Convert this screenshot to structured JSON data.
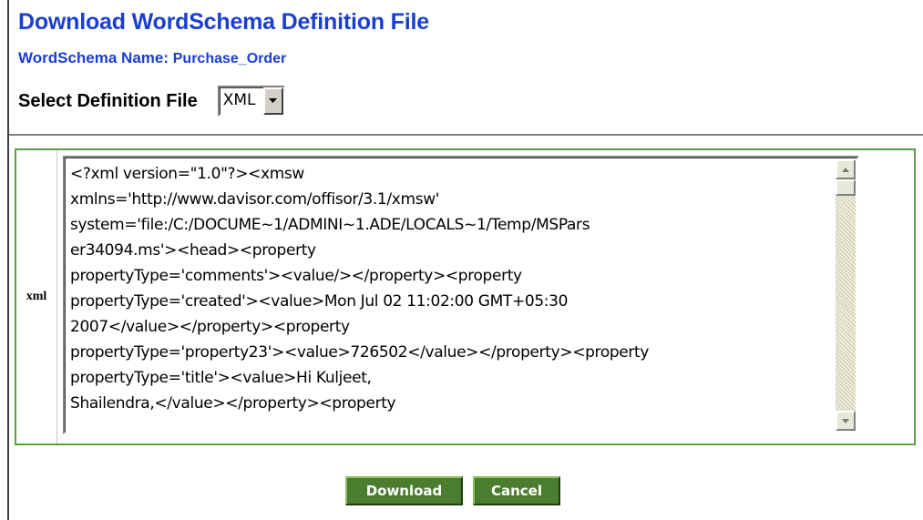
{
  "page": {
    "title": "Download WordSchema Definition File",
    "schema_label": "WordSchema Name:",
    "schema_name": "Purchase_Order"
  },
  "definition_select": {
    "label": "Select Definition File",
    "value": "XML"
  },
  "xml_panel": {
    "label": "xml",
    "content_lines": [
      "<?xml version=\"1.0\"?><xmsw",
      "xmlns='http://www.davisor.com/offisor/3.1/xmsw'",
      "system='file:/C:/DOCUME~1/ADMINI~1.ADE/LOCALS~1/Temp/MSPars",
      "er34094.ms'><head><property",
      "propertyType='comments'><value/></property><property",
      "propertyType='created'><value>Mon Jul 02 11:02:00 GMT+05:30",
      "2007</value></property><property",
      "propertyType='property23'><value>726502</value></property><property",
      "propertyType='title'><value>Hi Kuljeet,",
      "Shailendra,</value></property><property"
    ]
  },
  "actions": {
    "download_label": "Download",
    "cancel_label": "Cancel"
  },
  "colors": {
    "title_blue": "#1a3fd0",
    "panel_border_green": "#5aa03c",
    "button_green": "#4a7e2e"
  },
  "icons": {
    "select_arrow": "chevron-down-icon",
    "scroll_up": "scroll-up-arrow-icon",
    "scroll_down": "scroll-down-arrow-icon"
  }
}
